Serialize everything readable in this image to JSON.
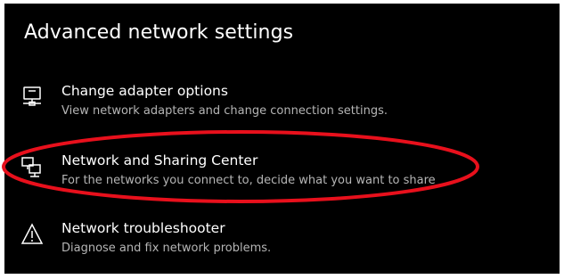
{
  "heading": "Advanced network settings",
  "items": [
    {
      "title": "Change adapter options",
      "description": "View network adapters and change connection settings.",
      "icon": "monitor-network-icon"
    },
    {
      "title": "Network and Sharing Center",
      "description": "For the networks you connect to, decide what you want to share",
      "icon": "network-sharing-icon"
    },
    {
      "title": "Network troubleshooter",
      "description": "Diagnose and fix network problems.",
      "icon": "warning-icon"
    }
  ],
  "colors": {
    "background": "#000000",
    "title": "#ffffff",
    "description": "#b5b5b5",
    "annotation": "#e8101c"
  }
}
